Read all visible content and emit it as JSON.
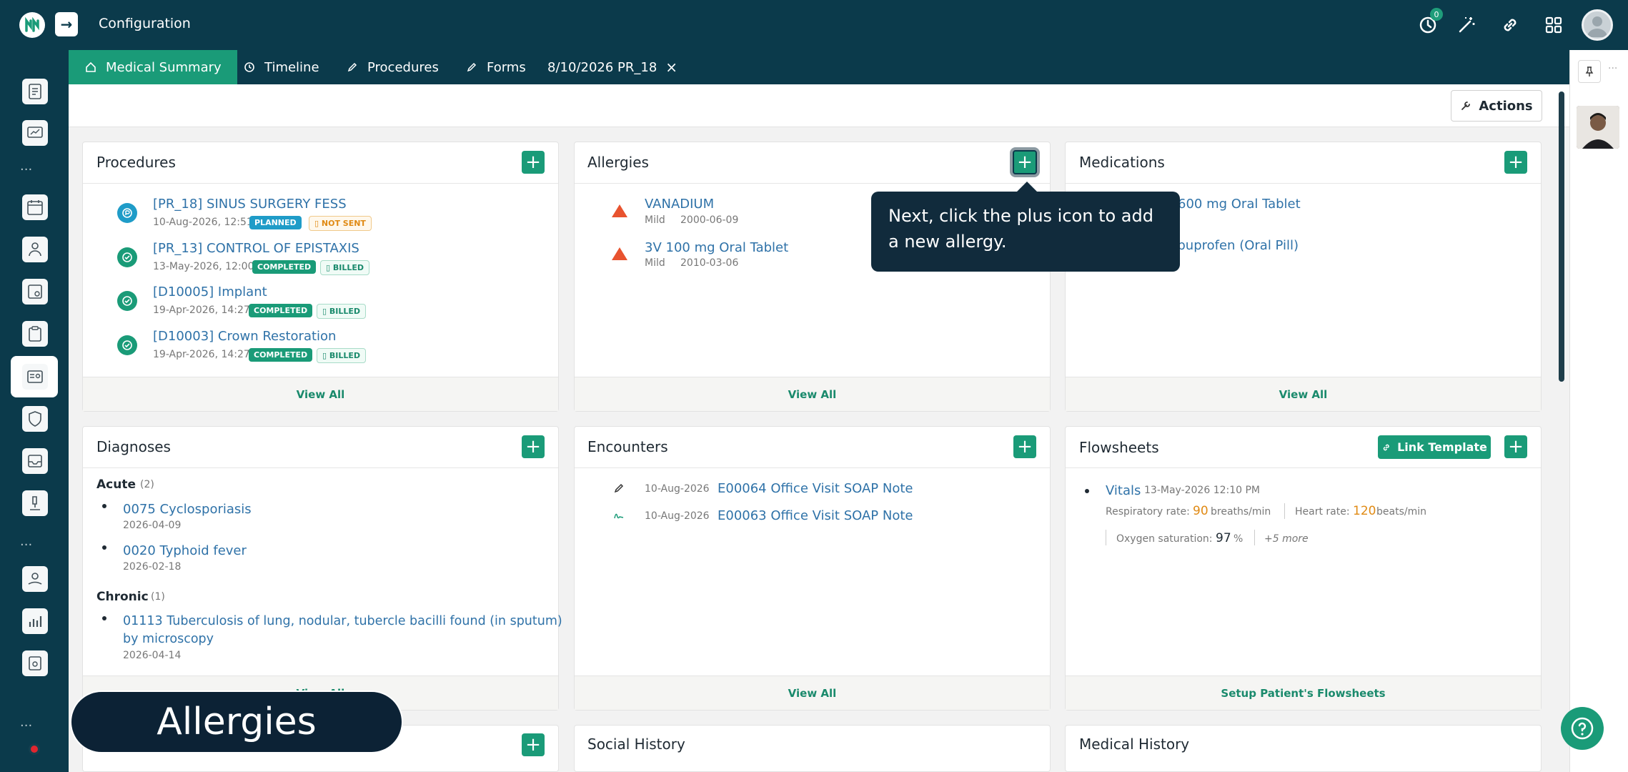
{
  "app": {
    "title": "Configuration",
    "notification_count": "0"
  },
  "tabs": [
    {
      "label": "Medical Summary"
    },
    {
      "label": "Timeline"
    },
    {
      "label": "Procedures"
    },
    {
      "label": "Forms"
    },
    {
      "label": "8/10/2026 PR_18"
    }
  ],
  "toolbar": {
    "actions_label": "Actions"
  },
  "procedures": {
    "title": "Procedures",
    "items": [
      {
        "name": "[PR_18] SINUS SURGERY FESS",
        "date": "10-Aug-2026, 12:51",
        "status": "PLANNED",
        "billing": "NOT SENT"
      },
      {
        "name": "[PR_13] CONTROL OF EPISTAXIS",
        "date": "13-May-2026, 12:00",
        "status": "COMPLETED",
        "billing": "BILLED"
      },
      {
        "name": "[D10005] Implant",
        "date": "19-Apr-2026, 14:27",
        "status": "COMPLETED",
        "billing": "BILLED"
      },
      {
        "name": "[D10003] Crown Restoration",
        "date": "19-Apr-2026, 14:27",
        "status": "COMPLETED",
        "billing": "BILLED"
      }
    ],
    "footer": "View All"
  },
  "allergies": {
    "title": "Allergies",
    "items": [
      {
        "name": "VANADIUM",
        "severity": "Mild",
        "date": "2000-06-09"
      },
      {
        "name": "3V 100 mg Oral Tablet",
        "severity": "Mild",
        "date": "2010-03-06"
      }
    ],
    "footer": "View All"
  },
  "medications": {
    "title": "Medications",
    "items": [
      {
        "name": "600 mg Oral Tablet"
      },
      {
        "name": "/Ibuprofen (Oral Pill)"
      }
    ],
    "footer": "View All"
  },
  "diagnoses": {
    "title": "Diagnoses",
    "acute_label": "Acute",
    "acute_count": "(2)",
    "acute": [
      {
        "name": "0075 Cyclosporiasis",
        "date": "2026-04-09"
      },
      {
        "name": "0020 Typhoid fever",
        "date": "2026-02-18"
      }
    ],
    "chronic_label": "Chronic",
    "chronic_count": "(1)",
    "chronic": [
      {
        "name_line1": "01113 Tuberculosis of lung, nodular, tubercle bacilli found (in sputum)",
        "name_line2": "by microscopy",
        "date": "2026-04-14"
      }
    ],
    "footer": "View All"
  },
  "encounters": {
    "title": "Encounters",
    "items": [
      {
        "date": "10-Aug-2026",
        "name": "E00064 Office Visit SOAP Note"
      },
      {
        "date": "10-Aug-2026",
        "name": "E00063 Office Visit SOAP Note"
      }
    ],
    "footer": "View All"
  },
  "flowsheets": {
    "title": "Flowsheets",
    "link_template_label": "Link Template",
    "vitals_label": "Vitals",
    "vitals_date": "13-May-2026 12:10 PM",
    "resp_label": "Respiratory rate:",
    "resp_value": "90",
    "resp_unit": "breaths/min",
    "hr_label": "Heart rate:",
    "hr_value": "120",
    "hr_unit": "beats/min",
    "o2_label": "Oxygen saturation:",
    "o2_value": "97",
    "o2_unit": "%",
    "more": "+5 more",
    "footer": "Setup Patient's Flowsheets"
  },
  "bottom_cards": {
    "social_history": "Social History",
    "medical_history": "Medical History"
  },
  "tooltip": {
    "text": "Next, click the plus icon to add a new allergy."
  },
  "caption": {
    "text": "Allergies"
  },
  "sidebar": {
    "dots": "..."
  },
  "colors": {
    "primary": "#1a9b78",
    "navbar": "#0b3a4b",
    "link": "#2f72a8",
    "warning": "#e08a14"
  }
}
